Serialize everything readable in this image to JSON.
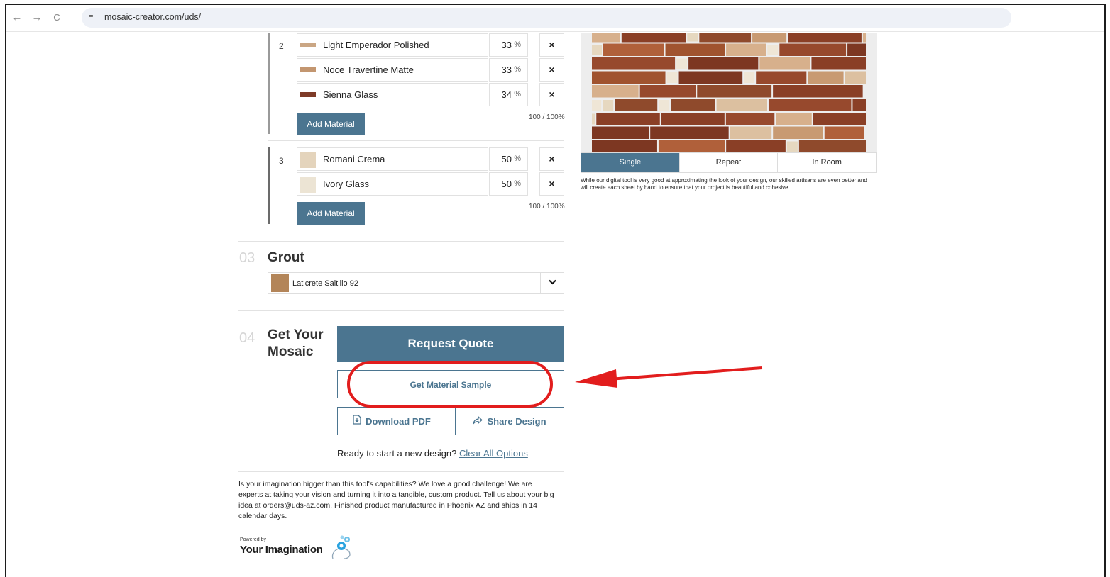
{
  "browser": {
    "url": "mosaic-creator.com/uds/",
    "back_icon": "←",
    "forward_icon": "→",
    "reload_icon": "C",
    "site_settings_icon": "≡"
  },
  "groups": [
    {
      "number": "2",
      "materials": [
        {
          "name": "Light Emperador Polished",
          "percent": "33",
          "color": "#caa684"
        },
        {
          "name": "Noce Travertine Matte",
          "percent": "33",
          "color": "#c39670"
        },
        {
          "name": "Sienna Glass",
          "percent": "34",
          "color": "#7e3b28"
        }
      ],
      "add_label": "Add Material",
      "total": "100 / 100%"
    },
    {
      "number": "3",
      "materials": [
        {
          "name": "Romani Crema",
          "percent": "50",
          "color": "#e4d4bc"
        },
        {
          "name": "Ivory Glass",
          "percent": "50",
          "color": "#ece4d4"
        }
      ],
      "add_label": "Add Material",
      "total": "100 / 100%"
    }
  ],
  "percent_sign": "%",
  "remove_icon": "×",
  "grout": {
    "number": "03",
    "title": "Grout",
    "selected": "Laticrete Saltillo 92",
    "color": "#b38559",
    "chevron": "⌄"
  },
  "get_mosaic": {
    "number": "04",
    "title_line1": "Get Your",
    "title_line2": "Mosaic",
    "request_quote": "Request Quote",
    "material_sample": "Get Material Sample",
    "download_pdf": "Download PDF",
    "share_design": "Share Design",
    "new_design_prompt": "Ready to start a new design?",
    "clear_all": "Clear All Options"
  },
  "description": "Is your imagination bigger than this tool's capabilities? We love a good challenge! We are experts at taking your vision and turning it into a tangible, custom product. Tell us about your big idea at orders@uds-az.com. Finished product manufactured in Phoenix AZ and ships in 14 calendar days.",
  "powered_by": {
    "small": "Powered by",
    "brand": "Your Imagination"
  },
  "preview": {
    "tabs": [
      "Single",
      "Repeat",
      "In Room"
    ],
    "active_tab": "Single",
    "disclaimer": "While our digital tool is very good at approximating the look of your design, our skilled artisans are even better and will create each sheet by hand to ensure that your project is beautiful and cohesive."
  }
}
